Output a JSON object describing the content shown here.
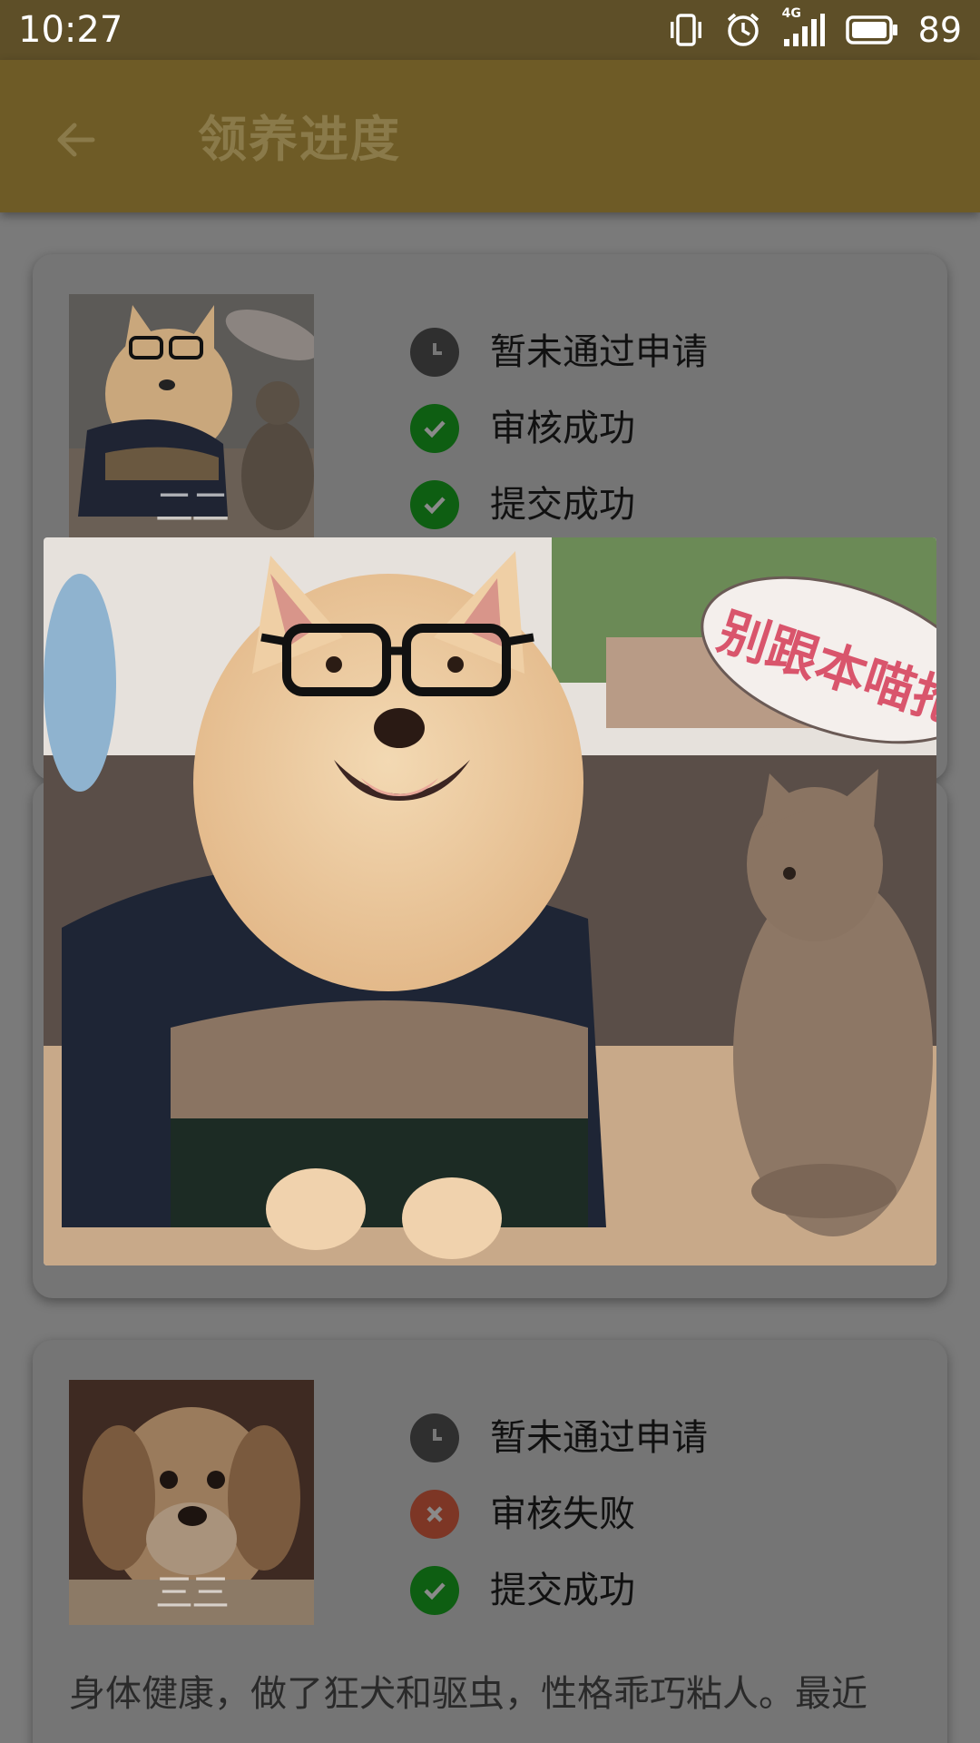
{
  "status_bar": {
    "time": "10:27",
    "network": "4G",
    "battery": "89",
    "icons": [
      "vibrate-icon",
      "alarm-icon",
      "signal-icon",
      "battery-icon"
    ]
  },
  "app_bar": {
    "title": "领养进度",
    "back_icon": "arrow-left-icon"
  },
  "cards": [
    {
      "statuses": [
        {
          "icon": "clock-icon",
          "text": "暂未通过申请"
        },
        {
          "icon": "check-icon",
          "text": "审核成功"
        },
        {
          "icon": "check-icon",
          "text": "提交成功"
        }
      ],
      "thumb_label": "二二"
    },
    {
      "statuses": [
        {
          "icon": "clock-icon",
          "text": "暂未通过申请"
        },
        {
          "icon": "close-icon",
          "text": "审核失败"
        },
        {
          "icon": "check-icon",
          "text": "提交成功"
        }
      ],
      "thumb_label": "三三",
      "description": "身体健康，做了狂犬和驱虫，性格乖巧粘人。最近"
    }
  ],
  "preview_image": {
    "caption_text": "别跟本喵抢"
  },
  "colors": {
    "status_bar": "#5e4f28",
    "app_bar": "#6e5b26",
    "scrim": "#7a7a7a",
    "success": "#0e5e12",
    "failure": "#7d3625",
    "pending": "#2f2f2f"
  }
}
